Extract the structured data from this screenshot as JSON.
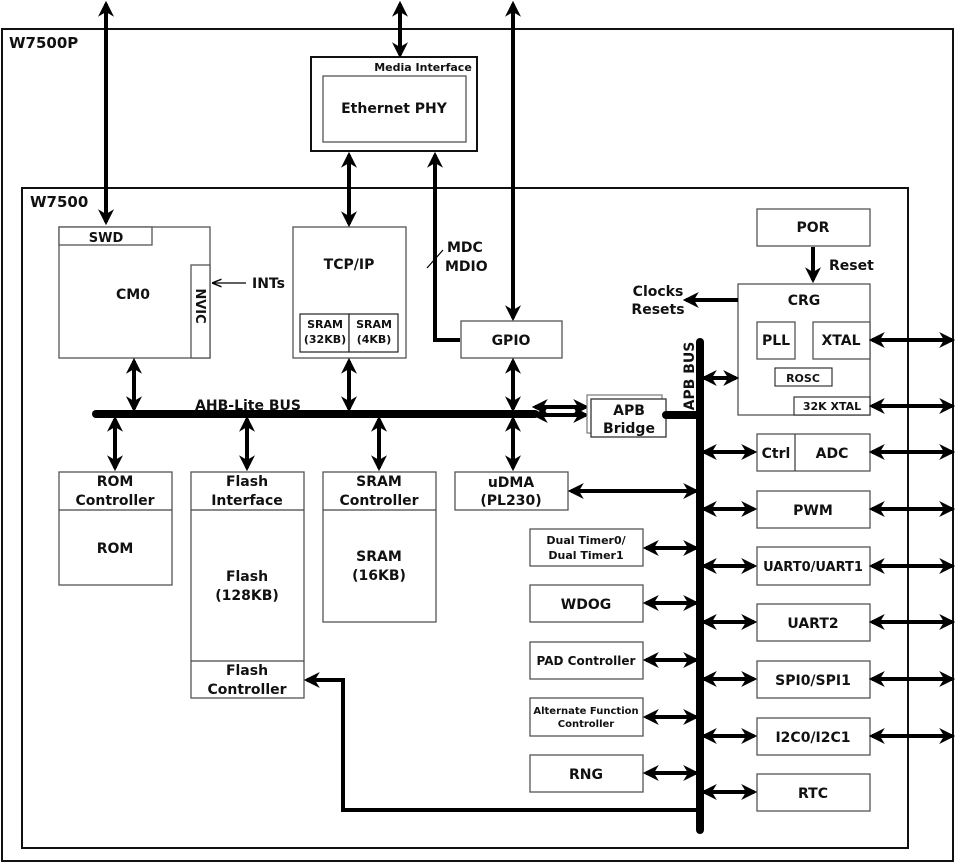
{
  "diagram": {
    "outer_chip": "W7500P",
    "inner_chip": "W7500",
    "media_interface": {
      "title": "Media Interface",
      "phy": "Ethernet PHY"
    },
    "cpu": {
      "name": "CM0",
      "swd": "SWD",
      "nvic": "NVIC",
      "ints_label": "INTs"
    },
    "tcpip": {
      "name": "TCP/IP",
      "sram_a": [
        "SRAM",
        "(32KB)"
      ],
      "sram_b": [
        "SRAM",
        "(4KB)"
      ]
    },
    "mdc_label": [
      "MDC",
      "MDIO"
    ],
    "gpio": "GPIO",
    "por": "POR",
    "reset_label": "Reset",
    "clocks_label": [
      "Clocks",
      "Resets"
    ],
    "crg": {
      "name": "CRG",
      "pll": "PLL",
      "xtal": "XTAL",
      "rosc": "ROSC",
      "xtal32k": "32K XTAL"
    },
    "ahb_bus": "AHB-Lite BUS",
    "apb_bus": "APB BUS",
    "apb_bridge": [
      "APB",
      "Bridge"
    ],
    "rom": {
      "ctrl": [
        "ROM",
        "Controller"
      ],
      "mem": "ROM"
    },
    "flash": {
      "iface": [
        "Flash",
        "Interface"
      ],
      "mem": [
        "Flash",
        "(128KB)"
      ],
      "ctrl": [
        "Flash",
        "Controller"
      ]
    },
    "sram": {
      "ctrl": [
        "SRAM",
        "Controller"
      ],
      "mem": [
        "SRAM",
        "(16KB)"
      ]
    },
    "udma": [
      "uDMA",
      "(PL230)"
    ],
    "left_peripherals": [
      [
        "Dual Timer0/",
        "Dual Timer1"
      ],
      [
        "WDOG"
      ],
      [
        "PAD Controller"
      ],
      [
        "Alternate Function",
        "Controller"
      ],
      [
        "RNG"
      ]
    ],
    "adc": {
      "ctrl": "Ctrl",
      "name": "ADC"
    },
    "right_peripherals": [
      "PWM",
      "UART0/UART1",
      "UART2",
      "SPI0/SPI1",
      "I2C0/I2C1",
      "RTC"
    ]
  }
}
